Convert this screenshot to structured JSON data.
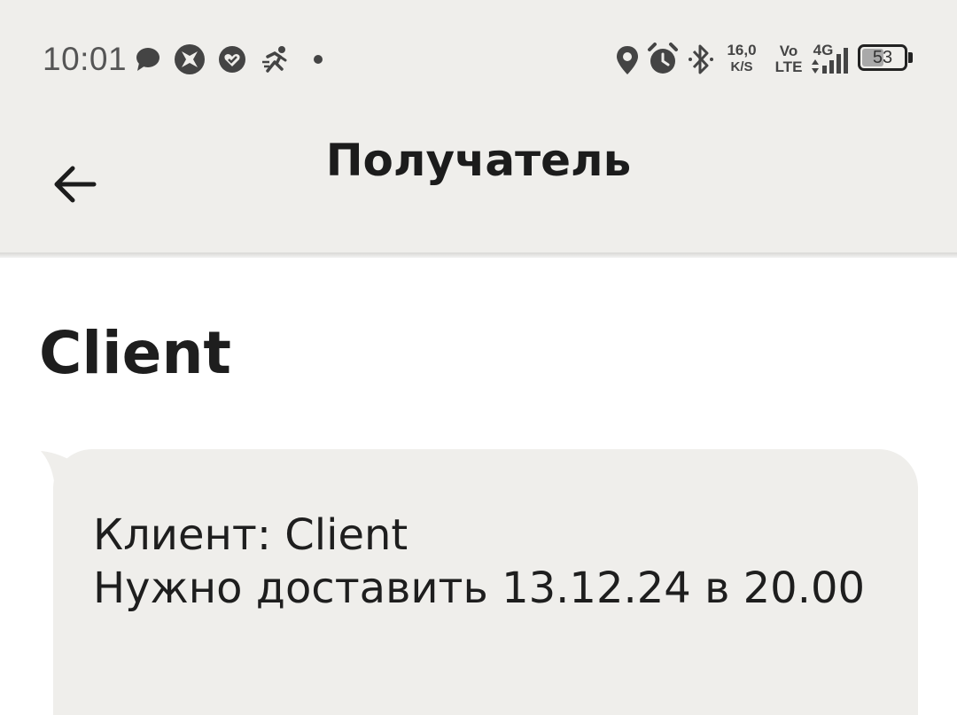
{
  "status_bar": {
    "time": "10:01",
    "net_speed_value": "16,0",
    "net_speed_unit": "K/S",
    "volte_top": "Vo",
    "volte_bottom": "LTE",
    "network_type": "4G",
    "battery_level": "53",
    "battery_fraction": 0.53,
    "icons": [
      "message-icon",
      "app-icon",
      "heart-icon",
      "running-icon",
      "dot-icon",
      "location-icon",
      "alarm-icon",
      "bluetooth-icon",
      "signal-icon",
      "battery-icon"
    ]
  },
  "app_bar": {
    "title": "Получатель",
    "back_icon": "arrow-left-icon"
  },
  "content": {
    "recipient_name": "Client",
    "message": {
      "line1": "Клиент: Client",
      "line2": "Нужно доставить 13.12.24 в 20.00"
    }
  },
  "colors": {
    "bar_background": "#efeeeb",
    "page_background": "#ffffff",
    "bubble_background": "#efeeeb",
    "text": "#1c1c1c"
  }
}
